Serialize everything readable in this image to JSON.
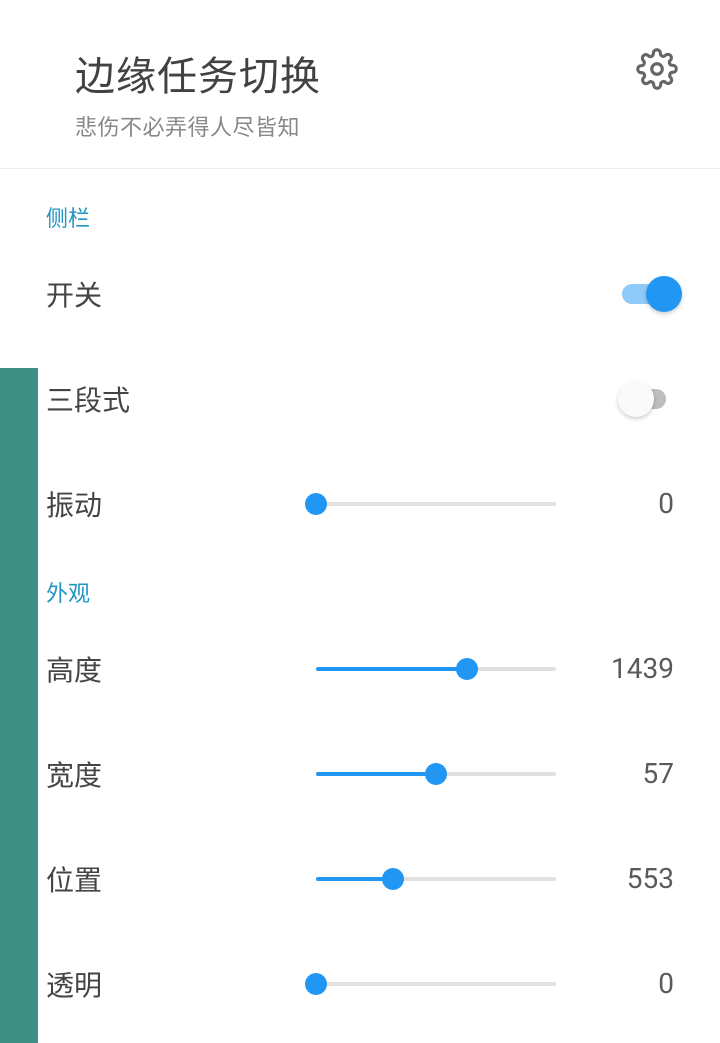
{
  "header": {
    "title": "边缘任务切换",
    "subtitle": "悲伤不必弄得人尽皆知"
  },
  "sections": {
    "sidebar": {
      "label": "侧栏"
    },
    "appearance": {
      "label": "外观"
    }
  },
  "controls": {
    "power": {
      "label": "开关",
      "on": true
    },
    "threeStage": {
      "label": "三段式",
      "on": false
    },
    "vibration": {
      "label": "振动",
      "value": "0",
      "percent": 0
    },
    "height": {
      "label": "高度",
      "value": "1439",
      "percent": 63
    },
    "width": {
      "label": "宽度",
      "value": "57",
      "percent": 50
    },
    "position": {
      "label": "位置",
      "value": "553",
      "percent": 32
    },
    "opacity": {
      "label": "透明",
      "value": "0",
      "percent": 0
    }
  }
}
